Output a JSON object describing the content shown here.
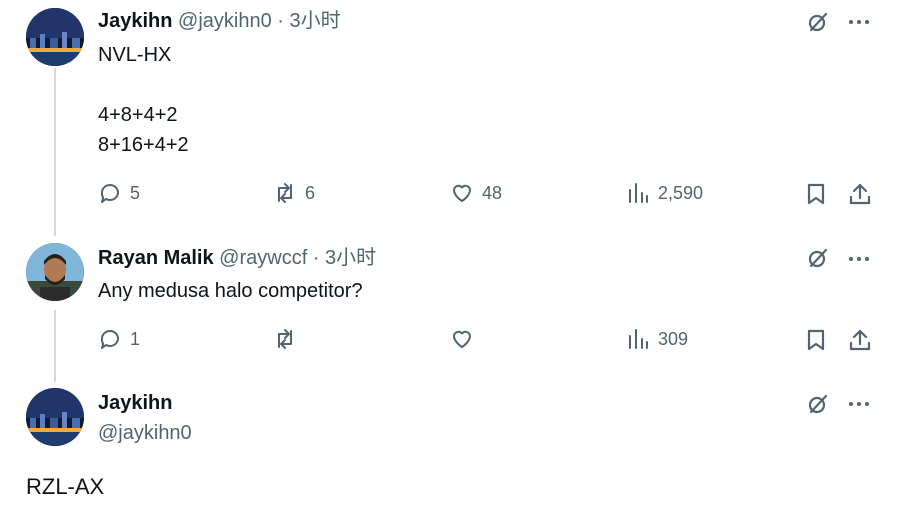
{
  "tweets": [
    {
      "name": "Jaykihn",
      "meta": "@jaykihn0 · 3小时",
      "text": "NVL-HX\n\n4+8+4+2\n8+16+4+2",
      "replies": "5",
      "retweets": "6",
      "likes": "48",
      "views": "2,590"
    },
    {
      "name": "Rayan Malik",
      "meta": "@raywccf · 3小时",
      "text": "Any medusa halo competitor?",
      "replies": "1",
      "retweets": "",
      "likes": "",
      "views": "309"
    },
    {
      "name": "Jaykihn",
      "handle": "@jaykihn0",
      "text": "RZL-AX"
    }
  ],
  "icons": {
    "reply": "reply-icon",
    "retweet": "retweet-icon",
    "like": "heart-icon",
    "views": "views-bar-chart-icon",
    "bookmark": "bookmark-icon",
    "share": "share-icon",
    "grok": "grok-icon",
    "more": "more-dots-icon"
  },
  "colors": {
    "text": "#0f1419",
    "secondary": "#536471",
    "thread_line": "#cfd9de"
  }
}
